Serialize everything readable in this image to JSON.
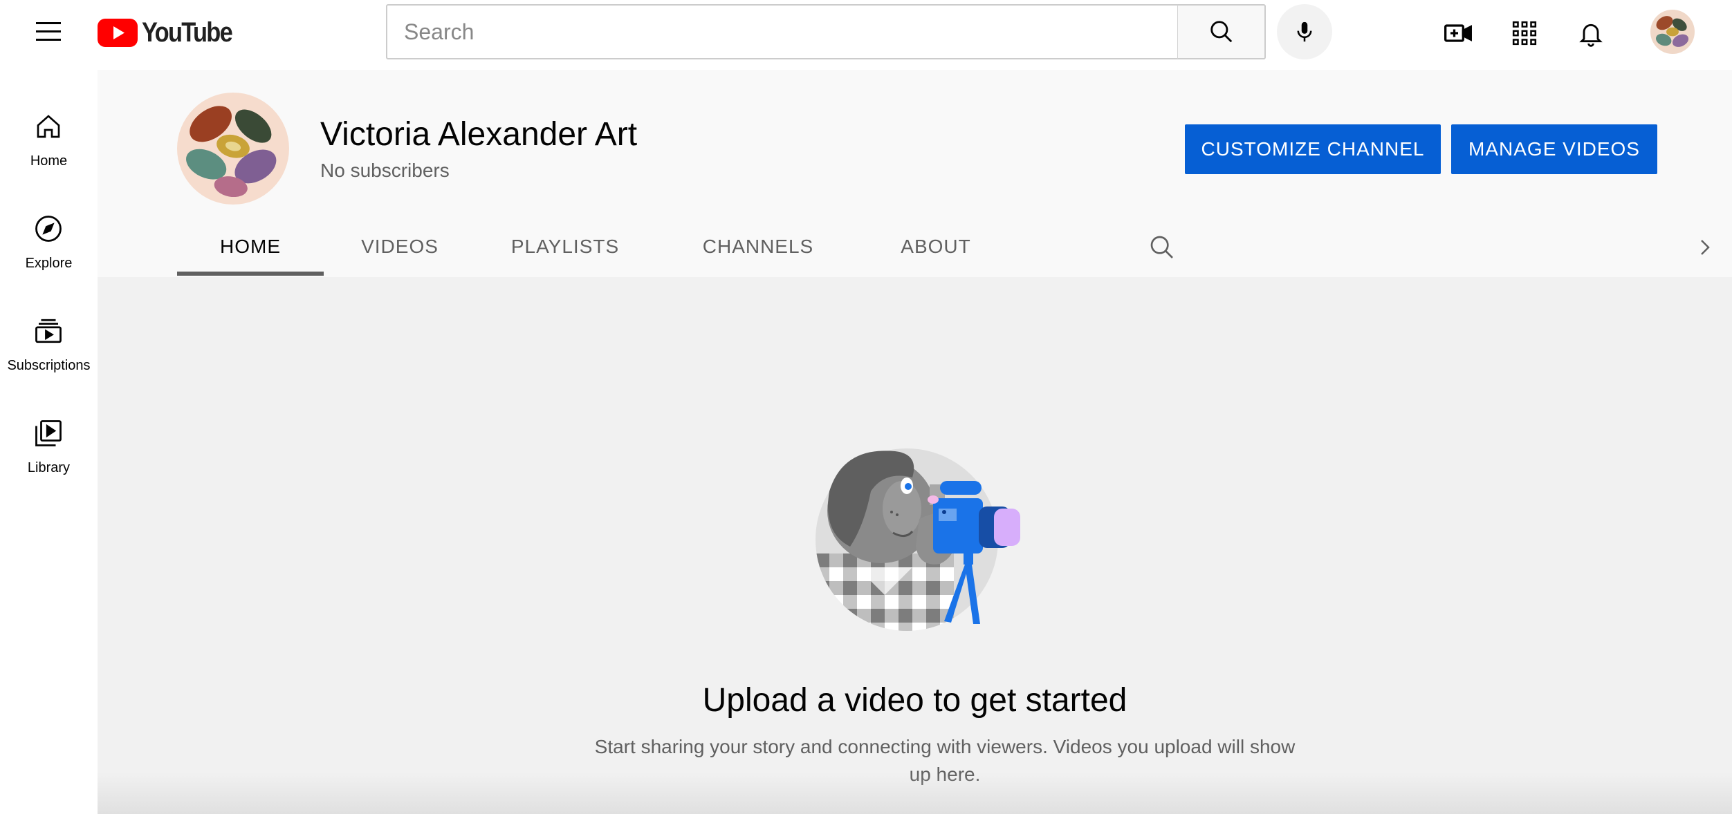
{
  "header": {
    "logo_text": "YouTube",
    "search": {
      "placeholder": "Search",
      "value": ""
    },
    "icons": [
      "menu-icon",
      "search-icon",
      "mic-icon",
      "create-video-icon",
      "apps-icon",
      "notifications-icon",
      "account-avatar"
    ]
  },
  "sidebar": {
    "items": [
      {
        "label": "Home",
        "icon": "home-icon"
      },
      {
        "label": "Explore",
        "icon": "compass-icon"
      },
      {
        "label": "Subscriptions",
        "icon": "subscriptions-icon"
      },
      {
        "label": "Library",
        "icon": "library-icon"
      }
    ]
  },
  "channel": {
    "name": "Victoria Alexander Art",
    "subscribers": "No subscribers",
    "customize_label": "CUSTOMIZE CHANNEL",
    "manage_label": "MANAGE VIDEOS",
    "tabs": [
      {
        "label": "HOME",
        "active": true
      },
      {
        "label": "VIDEOS",
        "active": false
      },
      {
        "label": "PLAYLISTS",
        "active": false
      },
      {
        "label": "CHANNELS",
        "active": false
      },
      {
        "label": "ABOUT",
        "active": false
      }
    ]
  },
  "empty_state": {
    "title": "Upload a video to get started",
    "description": "Start sharing your story and connecting with viewers. Videos you upload will show up here."
  },
  "colors": {
    "brand_red": "#ff0000",
    "button_blue": "#065fd4",
    "header_bg": "#f9f9f9",
    "content_bg": "#f1f1f1"
  }
}
